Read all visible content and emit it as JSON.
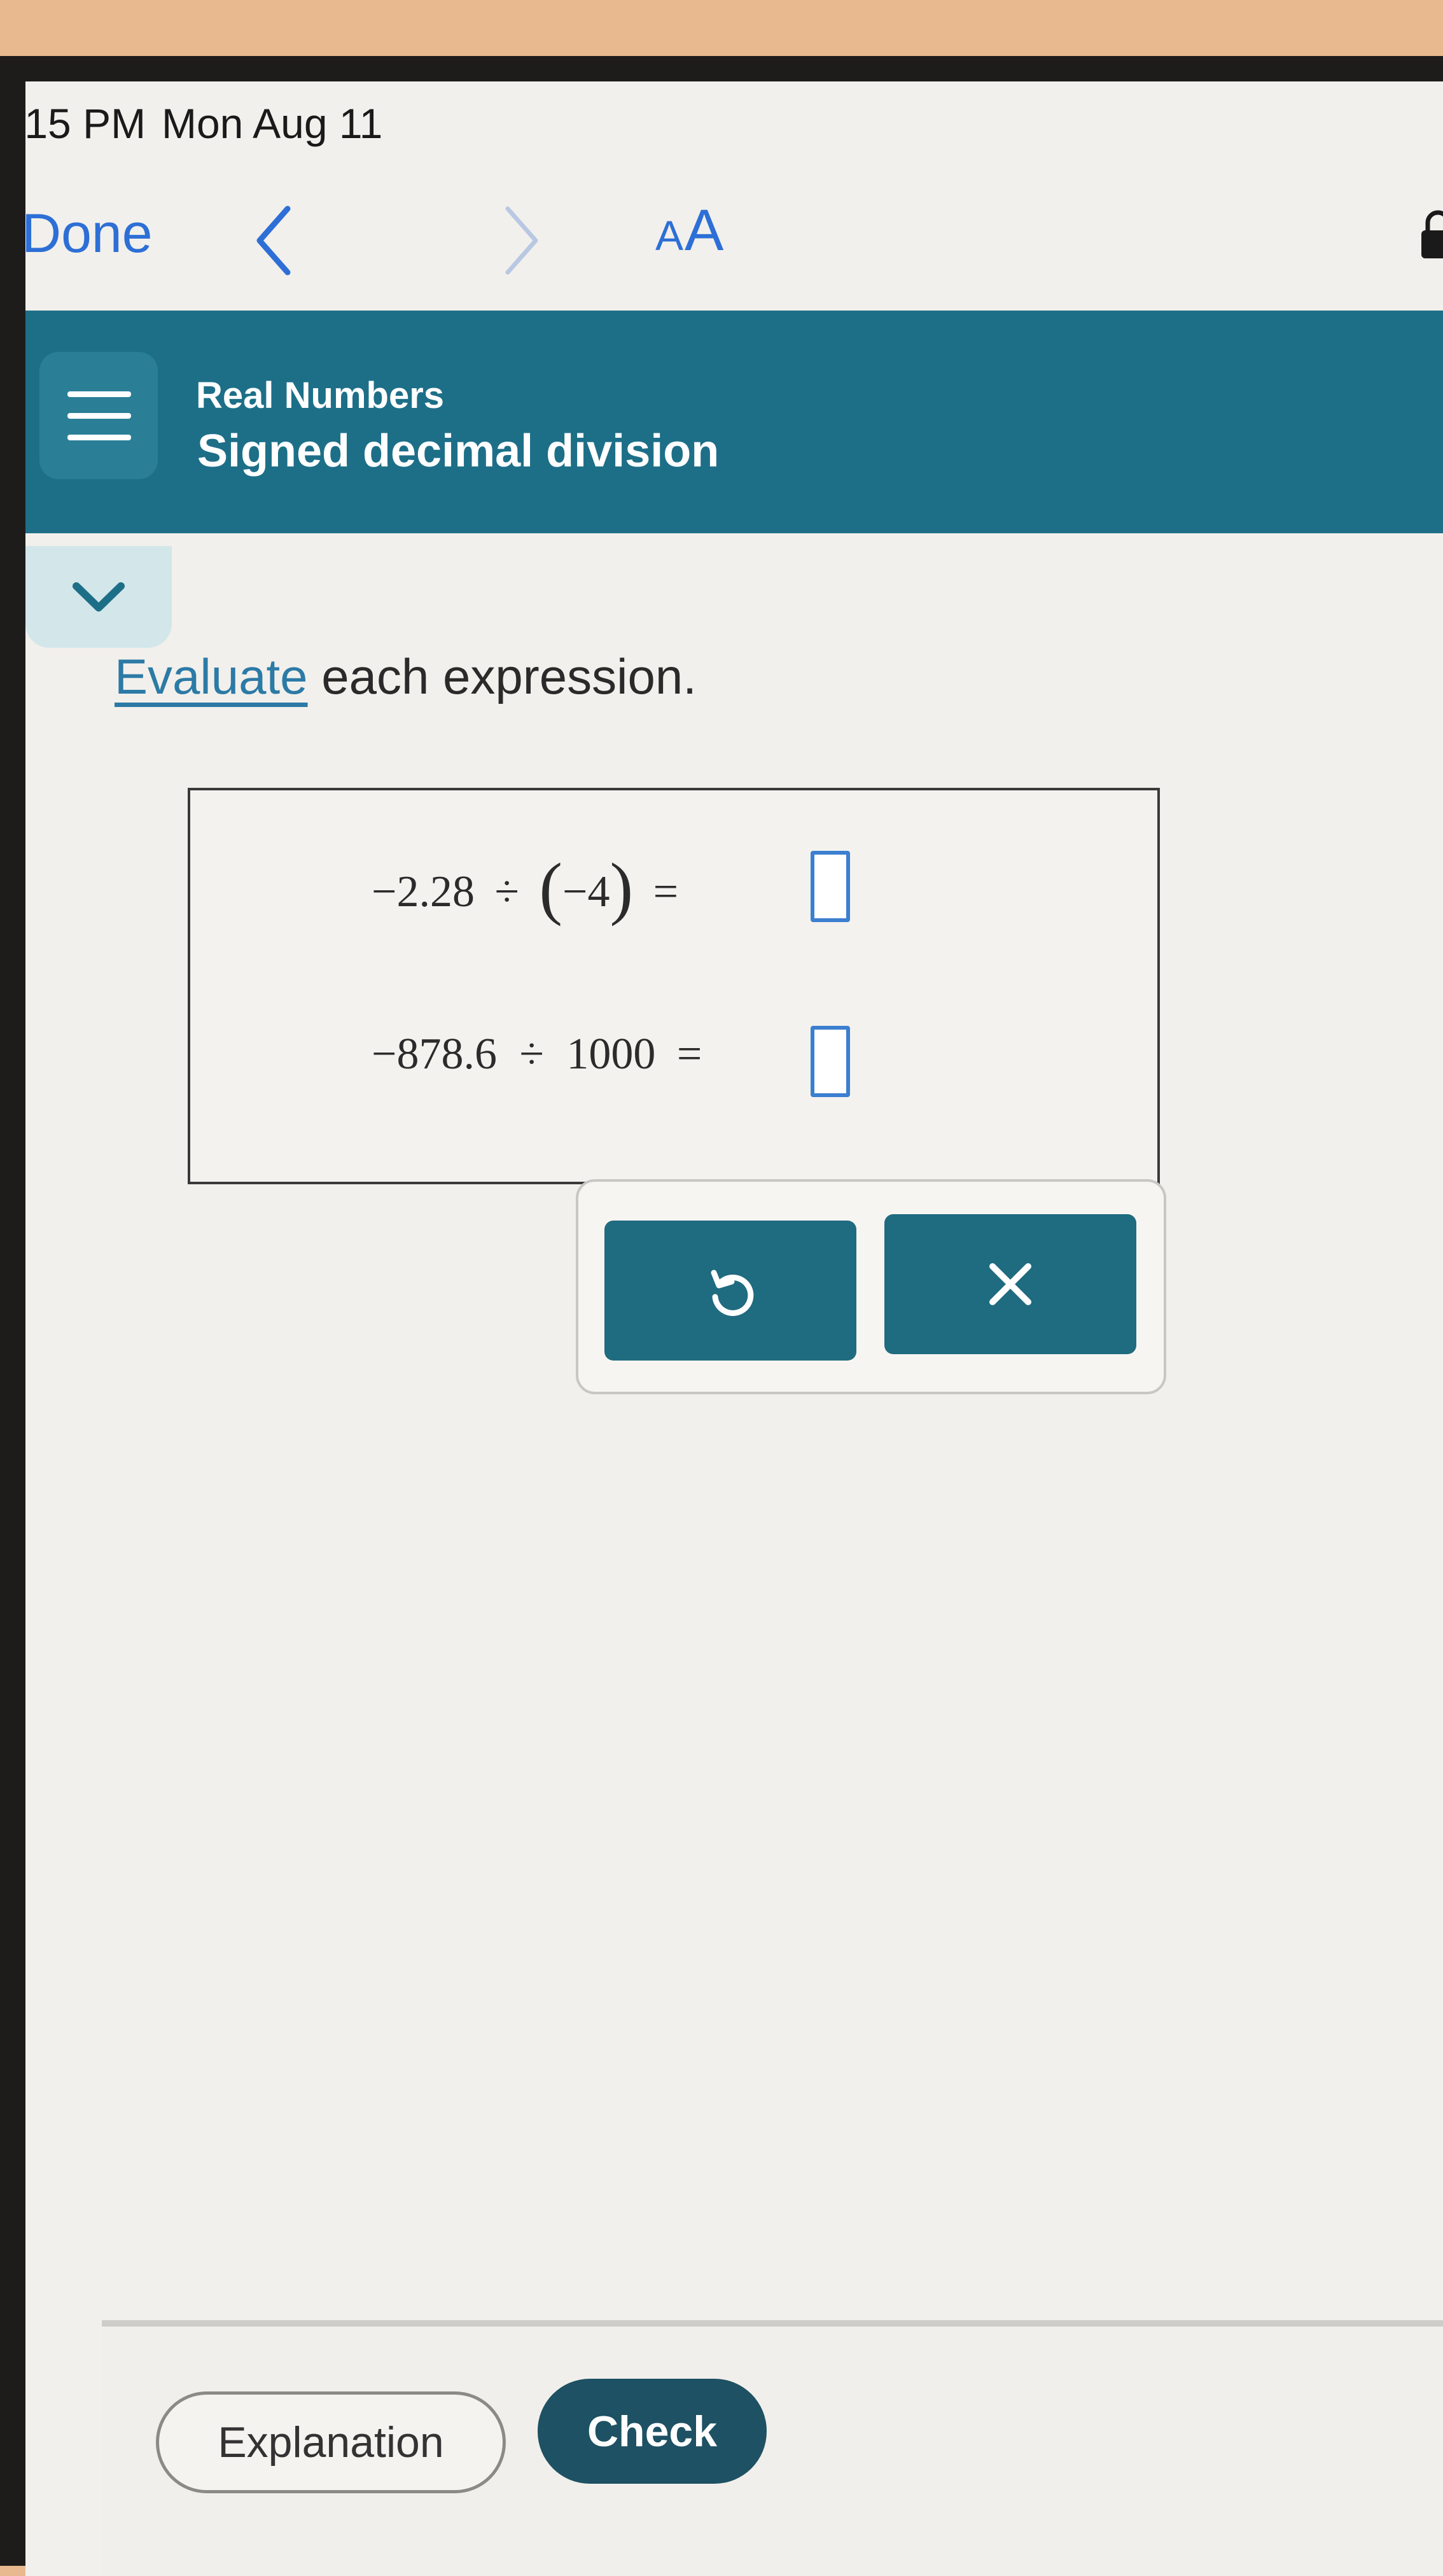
{
  "status_bar": {
    "time": ":15 PM",
    "date": "Mon Aug 11"
  },
  "toolbar": {
    "done_label": "Done",
    "text_size_small": "A",
    "text_size_large": "A",
    "back_icon": "chevron-left-icon",
    "forward_icon": "chevron-right-icon",
    "lock_icon": "lock-icon",
    "accent_color": "#2d6fd6"
  },
  "header": {
    "category": "Real Numbers",
    "title": "Signed decimal division",
    "background_color": "#1d6f88",
    "menu_icon": "hamburger-menu-icon",
    "collapse_icon": "chevron-down-icon"
  },
  "problem": {
    "instruction_link": "Evaluate",
    "instruction_rest": " each expression.",
    "expressions": [
      {
        "dividend": "−2.28",
        "operator": "÷",
        "open_paren": "(",
        "divisor": "−4",
        "close_paren": ")",
        "equals": "=",
        "answer": ""
      },
      {
        "dividend": "−878.6",
        "operator": "÷",
        "divisor": "1000",
        "equals": "=",
        "answer": ""
      }
    ]
  },
  "tools": {
    "undo_icon": "undo-icon",
    "clear_icon": "close-icon",
    "button_color": "#1f6b80"
  },
  "footer": {
    "explanation_label": "Explanation",
    "check_label": "Check",
    "check_color": "#1d5163"
  }
}
